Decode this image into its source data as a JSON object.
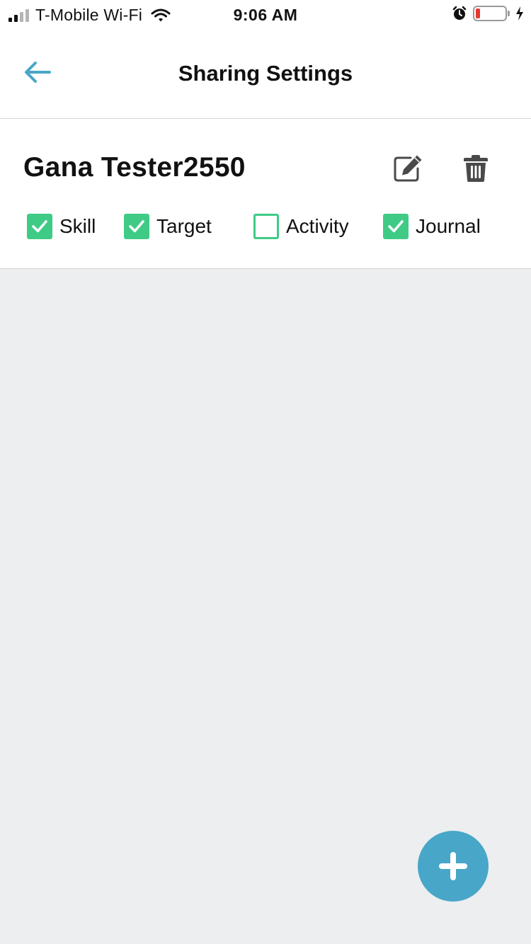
{
  "status_bar": {
    "carrier": "T-Mobile Wi-Fi",
    "time": "9:06 AM",
    "battery_level": 0.15,
    "icons": [
      "signal-icon",
      "wifi-icon",
      "alarm-icon",
      "battery-icon",
      "charging-icon"
    ]
  },
  "header": {
    "title": "Sharing Settings",
    "back_icon": "arrow-left-icon"
  },
  "contact": {
    "name": "Gana Tester2550",
    "edit_icon": "edit-icon",
    "delete_icon": "trash-icon",
    "permissions": [
      {
        "label": "Skill",
        "checked": true
      },
      {
        "label": "Target",
        "checked": true
      },
      {
        "label": "Activity",
        "checked": false
      },
      {
        "label": "Journal",
        "checked": true
      }
    ]
  },
  "fab": {
    "icon": "plus-icon"
  },
  "colors": {
    "accent": "#48a6c8",
    "check_green": "#3fcb86",
    "background": "#eceef0",
    "battery_low": "#e8392e"
  }
}
